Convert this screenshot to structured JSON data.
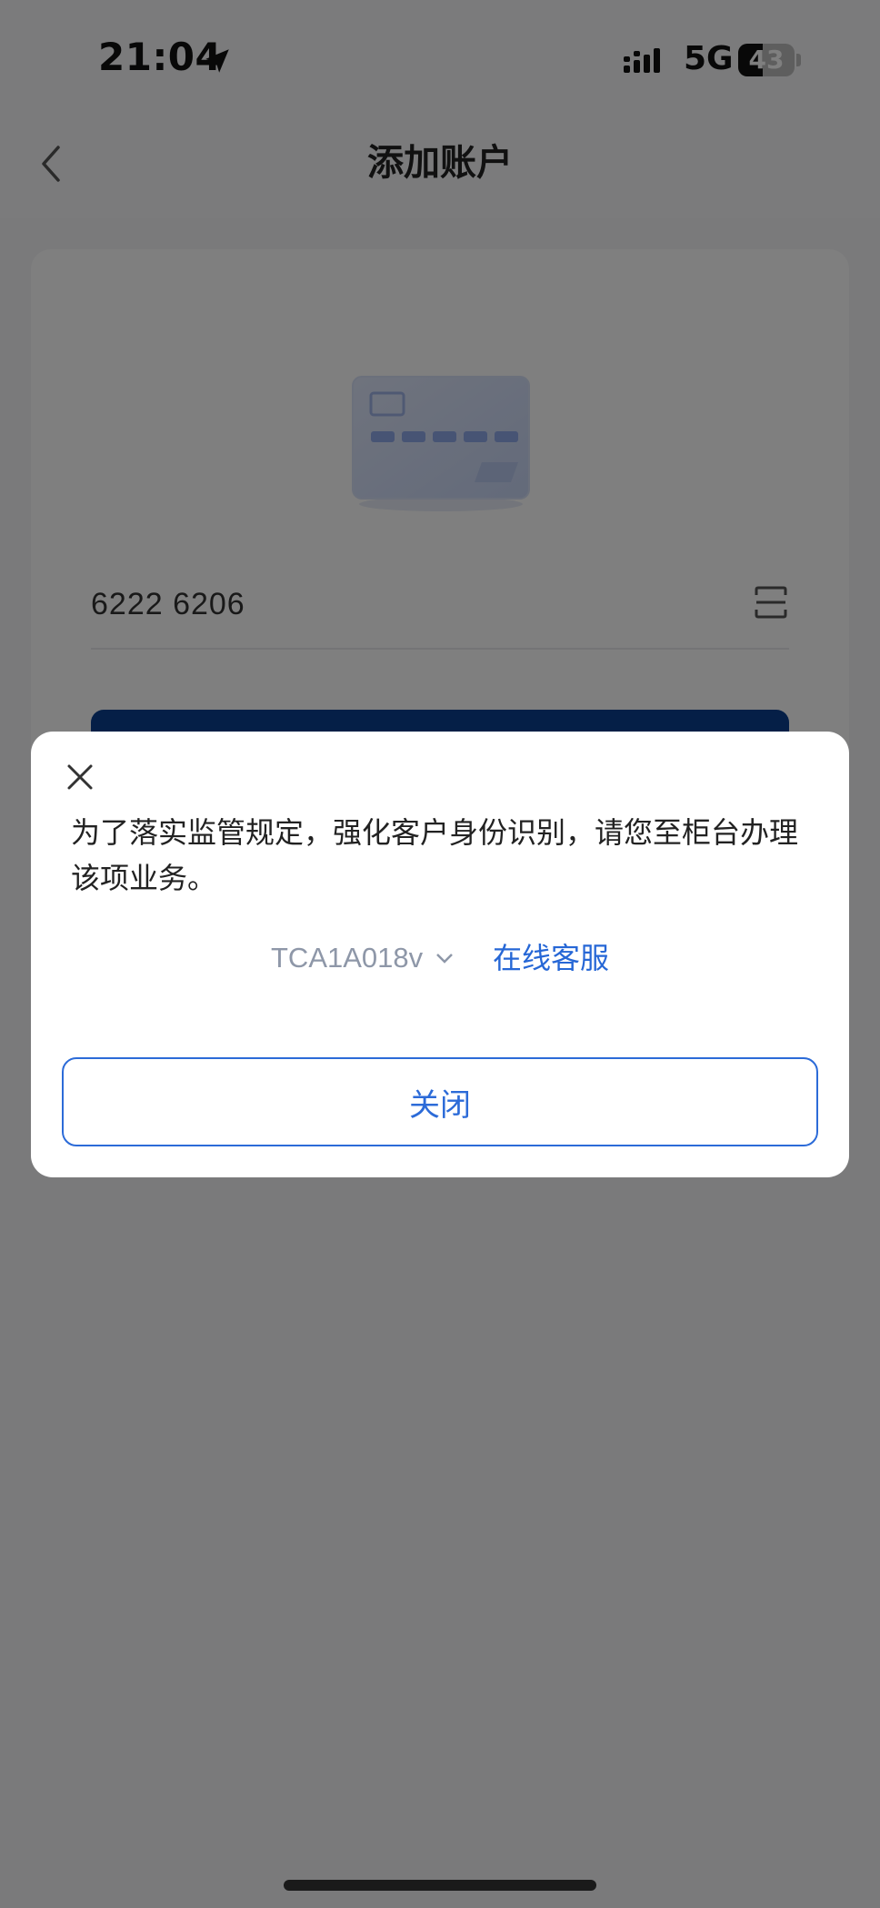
{
  "status_bar": {
    "time": "21:04",
    "network": "5G",
    "battery_level": "43",
    "battery_fraction": 0.43,
    "location_icon": "location-arrow-icon",
    "signal_icon": "cellular-signal-icon"
  },
  "nav": {
    "title": "添加账户",
    "back_icon": "chevron-left-icon"
  },
  "form": {
    "card_number": "6222 6206",
    "card_icon": "bank-card-icon",
    "scan_icon": "scan-icon"
  },
  "modal": {
    "message": "为了落实监管规定，强化客户身份识别，请您至柜台办理该项业务。",
    "error_code": "TCA1A018v",
    "online_service_label": "在线客服",
    "close_button_label": "关闭",
    "close_icon": "close-icon"
  },
  "colors": {
    "accent": "#2c6bd8",
    "primary_button": "#0b3f8f",
    "overlay": "rgba(0,0,0,0.5)"
  }
}
